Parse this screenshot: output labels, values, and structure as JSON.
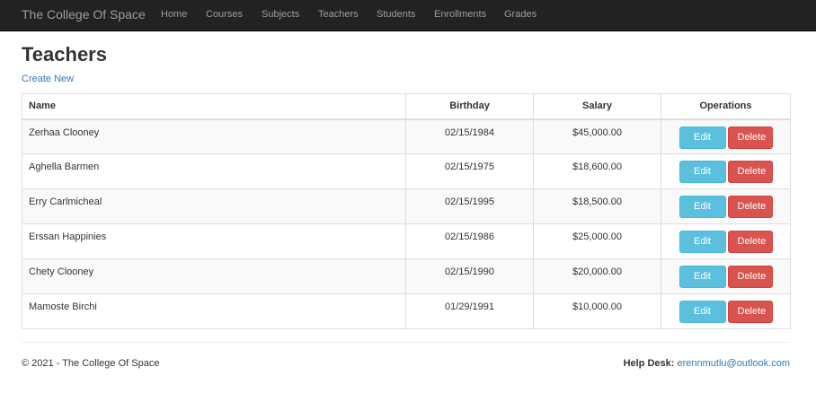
{
  "navbar": {
    "brand": "The College Of Space",
    "items": [
      "Home",
      "Courses",
      "Subjects",
      "Teachers",
      "Students",
      "Enrollments",
      "Grades"
    ]
  },
  "page": {
    "title": "Teachers",
    "create_link": "Create New"
  },
  "table": {
    "headers": {
      "name": "Name",
      "birthday": "Birthday",
      "salary": "Salary",
      "operations": "Operations"
    },
    "rows": [
      {
        "name": "Zerhaa Clooney",
        "birthday": "02/15/1984",
        "salary": "$45,000.00"
      },
      {
        "name": "Aghella Barmen",
        "birthday": "02/15/1975",
        "salary": "$18,600.00"
      },
      {
        "name": "Erry Carlmicheal",
        "birthday": "02/15/1995",
        "salary": "$18,500.00"
      },
      {
        "name": "Erssan Happinies",
        "birthday": "02/15/1986",
        "salary": "$25,000.00"
      },
      {
        "name": "Chety Clooney",
        "birthday": "02/15/1990",
        "salary": "$20,000.00"
      },
      {
        "name": "Mamoste Birchi",
        "birthday": "01/29/1991",
        "salary": "$10,000.00"
      }
    ],
    "edit_label": "Edit",
    "delete_label": "Delete"
  },
  "footer": {
    "copyright": "© 2021 - The College Of Space",
    "help_label": "Help Desk:",
    "help_email": "erennmutlu@outlook.com"
  },
  "colors": {
    "navbar_bg": "#222222",
    "link": "#337ab7",
    "edit_button": "#5bc0de",
    "delete_button": "#d9534f"
  }
}
